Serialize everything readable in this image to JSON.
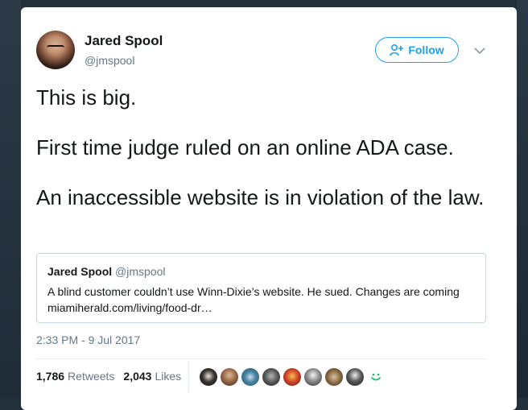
{
  "tweet": {
    "author": {
      "name": "Jared Spool",
      "handle": "@jmspool"
    },
    "follow_label": "Follow",
    "text": [
      "This is big.",
      "First time judge ruled on an online ADA case.",
      "An inaccessible website is in violation of the law."
    ],
    "quoted": {
      "name": "Jared Spool",
      "handle": "@jmspool",
      "text": "A blind customer couldn’t use Winn-Dixie’s website. He sued. Changes are coming",
      "link": "miamiherald.com/living/food-dr…"
    },
    "timestamp": "2:33 PM - 9 Jul 2017",
    "stats": {
      "retweets_count": "1,786",
      "retweets_label": "Retweets",
      "likes_count": "2,043",
      "likes_label": "Likes"
    }
  },
  "colors": {
    "accent": "#1da1f2",
    "text": "#14171a",
    "secondary": "#657786",
    "border": "#ccd6dd"
  },
  "icons": {
    "follow": "add-user-icon",
    "menu": "chevron-down-icon",
    "more_likers": "smile-icon"
  }
}
